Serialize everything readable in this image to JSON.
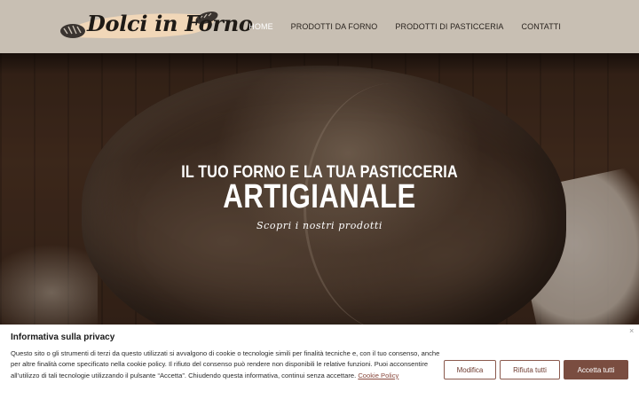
{
  "header": {
    "logo_text": "Dolci in Forno",
    "nav": [
      {
        "label": "HOME",
        "active": true
      },
      {
        "label": "PRODOTTI DA FORNO",
        "active": false
      },
      {
        "label": "PRODOTTI DI PASTICCERIA",
        "active": false
      },
      {
        "label": "CONTATTI",
        "active": false
      }
    ]
  },
  "hero": {
    "line1": "IL TUO FORNO E LA TUA PASTICCERIA",
    "line2": "ARTIGIANALE",
    "subtitle": "Scopri i nostri prodotti"
  },
  "cookie_banner": {
    "close_glyph": "×",
    "title": "Informativa sulla privacy",
    "text": "Questo sito o gli strumenti di terzi da questo utilizzati si avvalgono di cookie o tecnologie simili per finalità tecniche e, con il tuo consenso, anche per altre finalità come specificato nella cookie policy. Il rifiuto del consenso può rendere non disponibili le relative funzioni. Puoi acconsentire all’utilizzo di tali tecnologie utilizzando il pulsante “Accetta”. Chiudendo questa informativa, continui senza accettare.",
    "link_label": "Cookie Policy",
    "buttons": {
      "customize": "Modifica",
      "reject": "Rifiuta tutti",
      "accept": "Accetta tutti"
    }
  },
  "colors": {
    "header_bg": "#c8bfb3",
    "accent": "#7a4d40",
    "nav_active": "#ffffff"
  },
  "icons": {
    "logo": "bread-loaf-icon",
    "close": "close-icon"
  }
}
